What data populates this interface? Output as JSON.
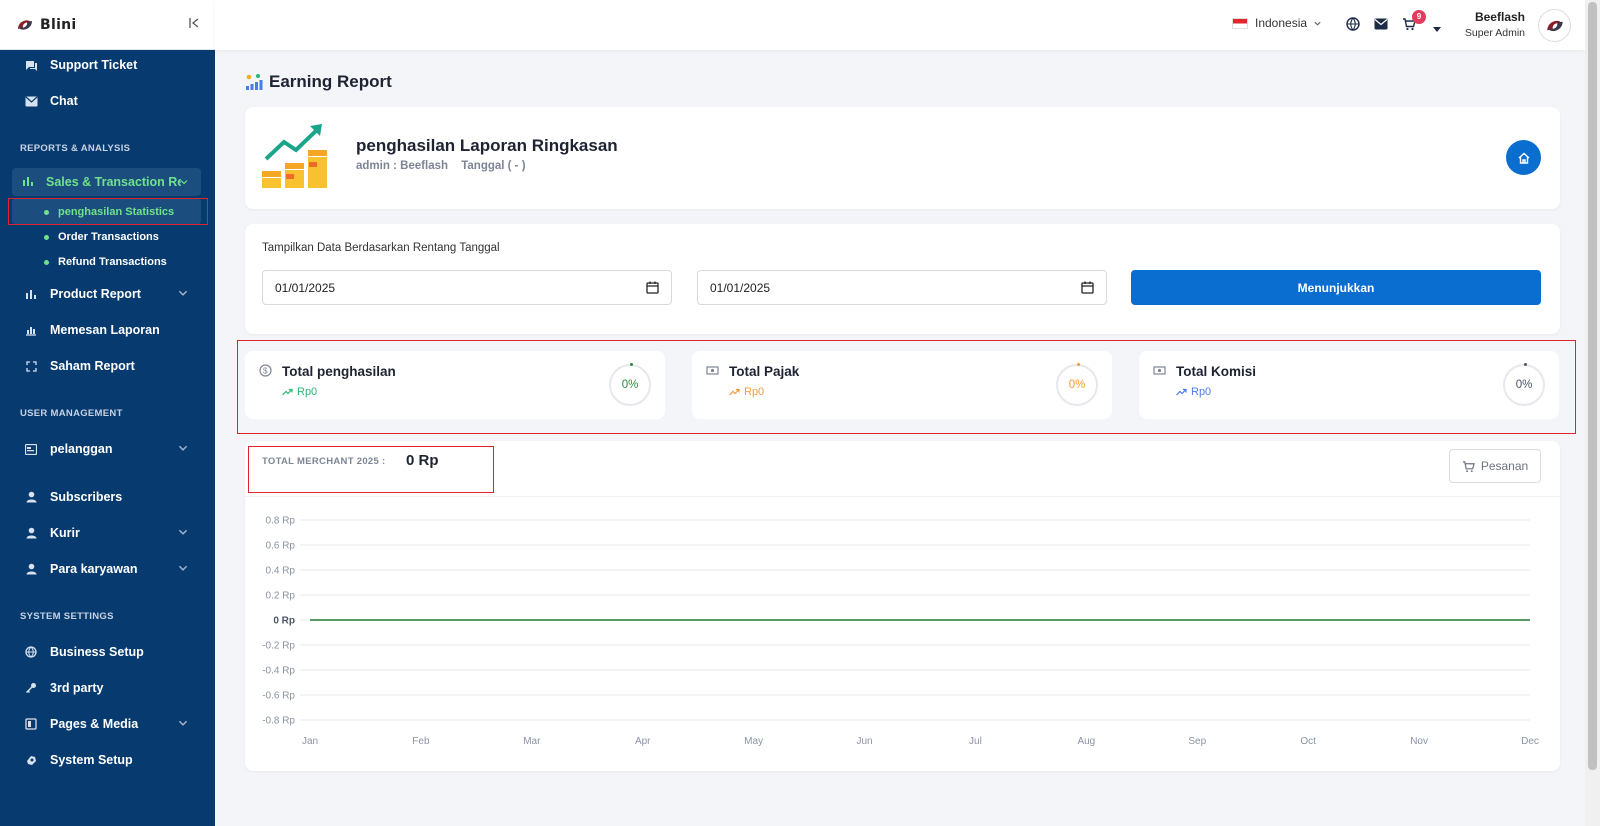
{
  "brand": {
    "name": "Blini"
  },
  "sidebar": {
    "items_top": [
      {
        "label": "Support Ticket",
        "icon": "ticket-icon"
      },
      {
        "label": "Chat",
        "icon": "mail-icon"
      }
    ],
    "section_reports": "REPORTS & ANALYSIS",
    "sales_group": {
      "label": "Sales & Transaction Report",
      "icon": "bar-chart-icon"
    },
    "sales_sub": [
      {
        "label": "penghasilan Statistics",
        "active": true
      },
      {
        "label": "Order Transactions"
      },
      {
        "label": "Refund Transactions"
      }
    ],
    "reports_items": [
      {
        "label": "Product Report",
        "icon": "bar-chart-icon"
      },
      {
        "label": "Memesan Laporan",
        "icon": "chart-icon"
      },
      {
        "label": "Saham Report",
        "icon": "expand-icon"
      }
    ],
    "section_users": "USER MANAGEMENT",
    "user_items": [
      {
        "label": "pelanggan",
        "icon": "id-card-icon"
      },
      {
        "label": "Subscribers",
        "icon": "user-icon"
      },
      {
        "label": "Kurir",
        "icon": "user-icon"
      },
      {
        "label": "Para karyawan",
        "icon": "user-icon"
      }
    ],
    "section_system": "SYSTEM SETTINGS",
    "system_items": [
      {
        "label": "Business Setup",
        "icon": "globe-icon"
      },
      {
        "label": "3rd party",
        "icon": "key-icon"
      },
      {
        "label": "Pages & Media",
        "icon": "pages-icon"
      },
      {
        "label": "System Setup",
        "icon": "gear-icon"
      }
    ]
  },
  "topbar": {
    "language": "Indonesia",
    "cart_count": "9",
    "user_name": "Beeflash",
    "user_role": "Super Admin"
  },
  "page": {
    "title": "Earning Report",
    "hero_title": "penghasilan Laporan Ringkasan",
    "hero_admin": "admin : Beeflash",
    "hero_date": "Tanggal  ( - )"
  },
  "filter": {
    "label": "Tampilkan Data Berdasarkan Rentang Tanggal",
    "start_date": "01/01/2025",
    "end_date": "01/01/2025",
    "show_button": "Menunjukkan"
  },
  "stats": [
    {
      "title": "Total penghasilan",
      "value": "Rp0",
      "percent": "0%",
      "color": "#2bb673"
    },
    {
      "title": "Total Pajak",
      "value": "Rp0",
      "percent": "0%",
      "color": "#f39a3c"
    },
    {
      "title": "Total Komisi",
      "value": "Rp0",
      "percent": "0%",
      "color": "#4a7be8"
    }
  ],
  "merchant": {
    "label": "TOTAL MERCHANT 2025 :",
    "value": "0  Rp",
    "orders_button": "Pesanan"
  },
  "chart_data": {
    "type": "line",
    "categories": [
      "Jan",
      "Feb",
      "Mar",
      "Apr",
      "May",
      "Jun",
      "Jul",
      "Aug",
      "Sep",
      "Oct",
      "Nov",
      "Dec"
    ],
    "series": [
      {
        "values": [
          0,
          0,
          0,
          0,
          0,
          0,
          0,
          0,
          0,
          0,
          0,
          0
        ],
        "color": "#1e7a2e"
      }
    ],
    "y_ticks": [
      "0.8 Rp",
      "0.6 Rp",
      "0.4 Rp",
      "0.2 Rp",
      "0 Rp",
      "-0.2 Rp",
      "-0.4 Rp",
      "-0.6 Rp",
      "-0.8 Rp"
    ],
    "ylim": [
      -0.8,
      0.8
    ],
    "grid": true
  }
}
